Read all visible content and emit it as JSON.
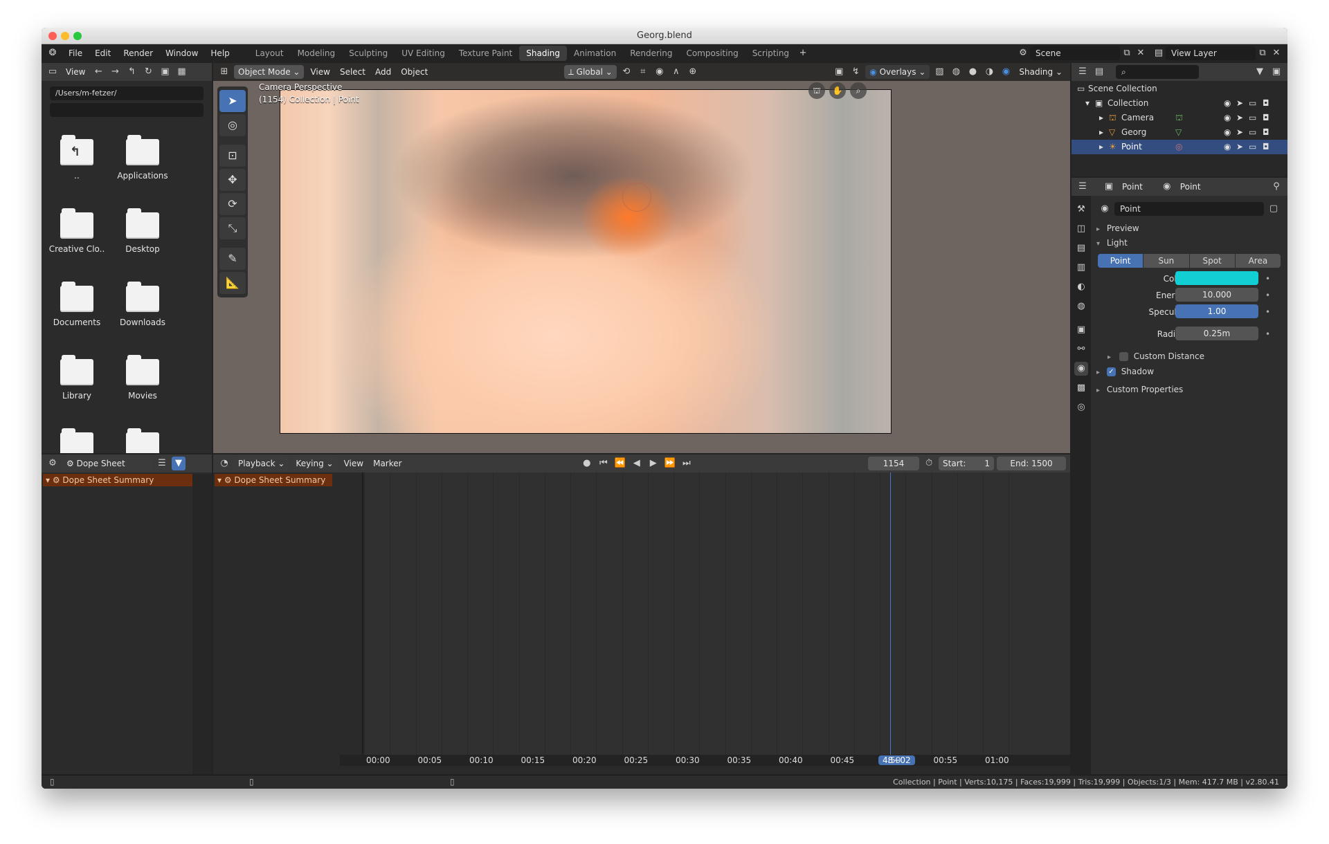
{
  "window": {
    "title": "Georg.blend"
  },
  "menu": [
    "File",
    "Edit",
    "Render",
    "Window",
    "Help"
  ],
  "workspaces": [
    "Layout",
    "Modeling",
    "Sculpting",
    "UV Editing",
    "Texture Paint",
    "Shading",
    "Animation",
    "Rendering",
    "Compositing",
    "Scripting"
  ],
  "active_workspace": "Shading",
  "scene": {
    "label": "Scene",
    "view_layer": "View Layer"
  },
  "file_browser": {
    "view_label": "View",
    "path": "/Users/m-fetzer/",
    "items": [
      "..",
      "Applications",
      "Creative Clo..",
      "Desktop",
      "Documents",
      "Downloads",
      "Library",
      "Movies",
      "",
      ""
    ]
  },
  "viewport": {
    "mode": "Object Mode",
    "menus": [
      "View",
      "Select",
      "Add",
      "Object"
    ],
    "transform": "Global",
    "overlays": "Overlays",
    "shading": "Shading",
    "camera_text": "Camera Perspective",
    "info_text": "(1154) Collection | Point"
  },
  "outliner": {
    "root": "Scene Collection",
    "collection": "Collection",
    "objects": [
      "Camera",
      "Georg",
      "Point"
    ]
  },
  "properties": {
    "breadcrumb_object": "Point",
    "breadcrumb_data": "Point",
    "data_name": "Point",
    "sections": {
      "preview": "Preview",
      "light": "Light",
      "custom_distance": "Custom Distance",
      "shadow": "Shadow",
      "custom_props": "Custom Properties"
    },
    "light_types": [
      "Point",
      "Sun",
      "Spot",
      "Area"
    ],
    "active_light_type": "Point",
    "fields": {
      "color_label": "Color",
      "color_value": "#11cfd3",
      "energy_label": "Energy",
      "energy_value": "10.000",
      "specular_label": "Specular",
      "specular_value": "1.00",
      "radius_label": "Radius",
      "radius_value": "0.25m"
    }
  },
  "dopesheet_left": {
    "editor": "Dope Sheet",
    "summary": "Dope Sheet Summary"
  },
  "timeline": {
    "menus": [
      "Playback",
      "Keying",
      "View",
      "Marker"
    ],
    "current_frame": "1154",
    "start_label": "Start:",
    "start_value": "1",
    "end_label": "End:",
    "end_value": "1500",
    "summary": "Dope Sheet Summary",
    "time_labels": [
      "00:00",
      "00:05",
      "00:10",
      "00:15",
      "00:20",
      "00:25",
      "00:30",
      "00:35",
      "00:40",
      "00:45",
      "48+02",
      ":50",
      "00:55",
      "01:00"
    ]
  },
  "statusbar": {
    "text": "Collection | Point | Verts:10,175 | Faces:19,999 | Tris:19,999 | Objects:1/3 | Mem: 417.7 MB | v2.80.41"
  }
}
